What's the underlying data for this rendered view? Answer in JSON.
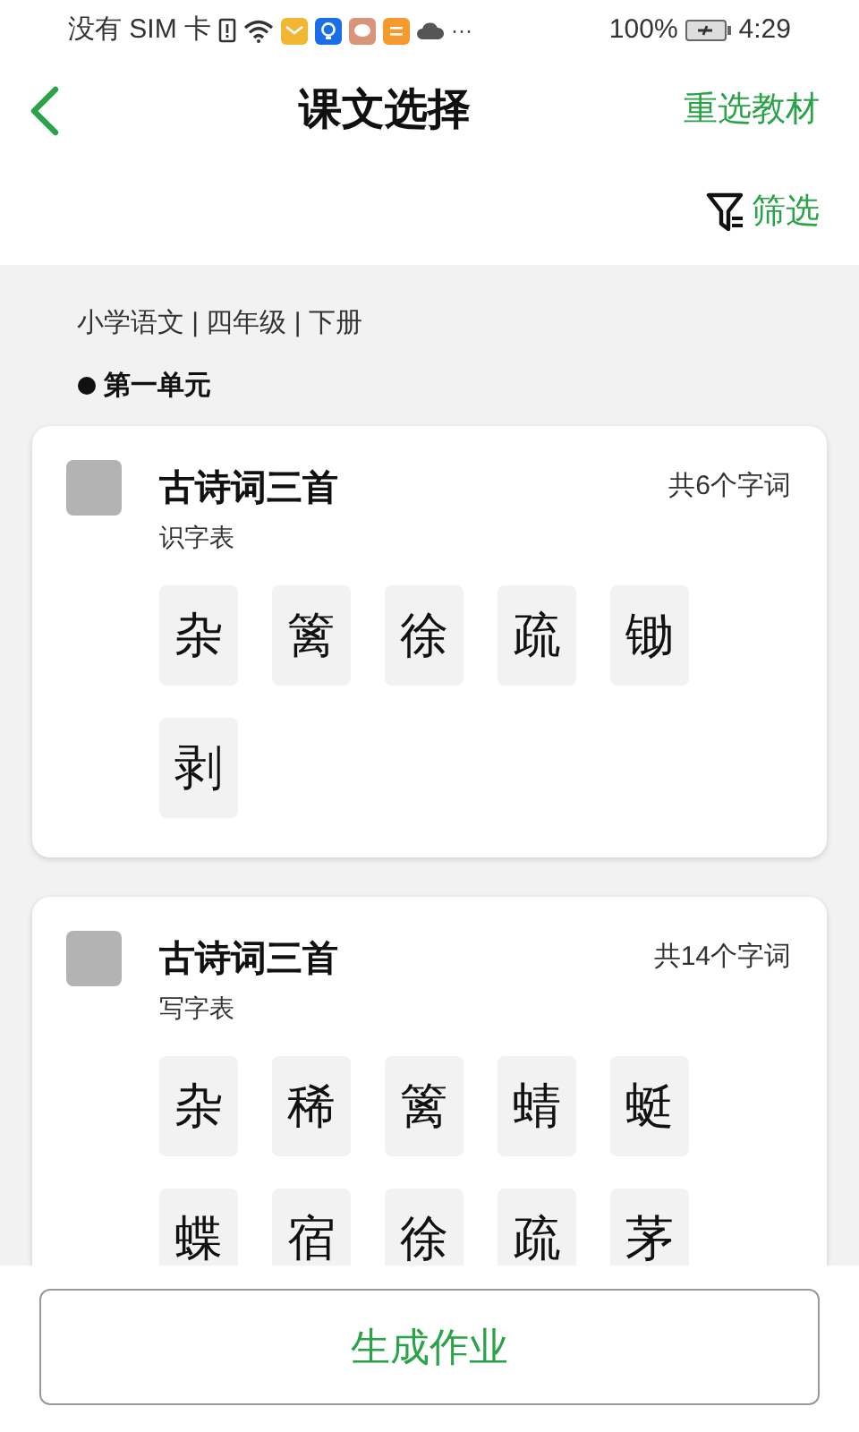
{
  "status_bar": {
    "carrier": "没有 SIM 卡",
    "more": "···",
    "battery_text": "100%",
    "time": "4:29"
  },
  "header": {
    "title": "课文选择",
    "action": "重选教材",
    "filter": "筛选"
  },
  "breadcrumb": "小学语文 | 四年级 | 下册",
  "unit": "第一单元",
  "lessons": [
    {
      "title": "古诗词三首",
      "count": "共6个字词",
      "table": "识字表",
      "checked": false,
      "chars": [
        "杂",
        "篱",
        "徐",
        "疏",
        "锄",
        "剥"
      ]
    },
    {
      "title": "古诗词三首",
      "count": "共14个字词",
      "table": "写字表",
      "checked": false,
      "chars": [
        "杂",
        "稀",
        "篱",
        "蜻",
        "蜓",
        "蝶",
        "宿",
        "徐",
        "疏",
        "茅"
      ]
    }
  ],
  "generate_button": "生成作业"
}
